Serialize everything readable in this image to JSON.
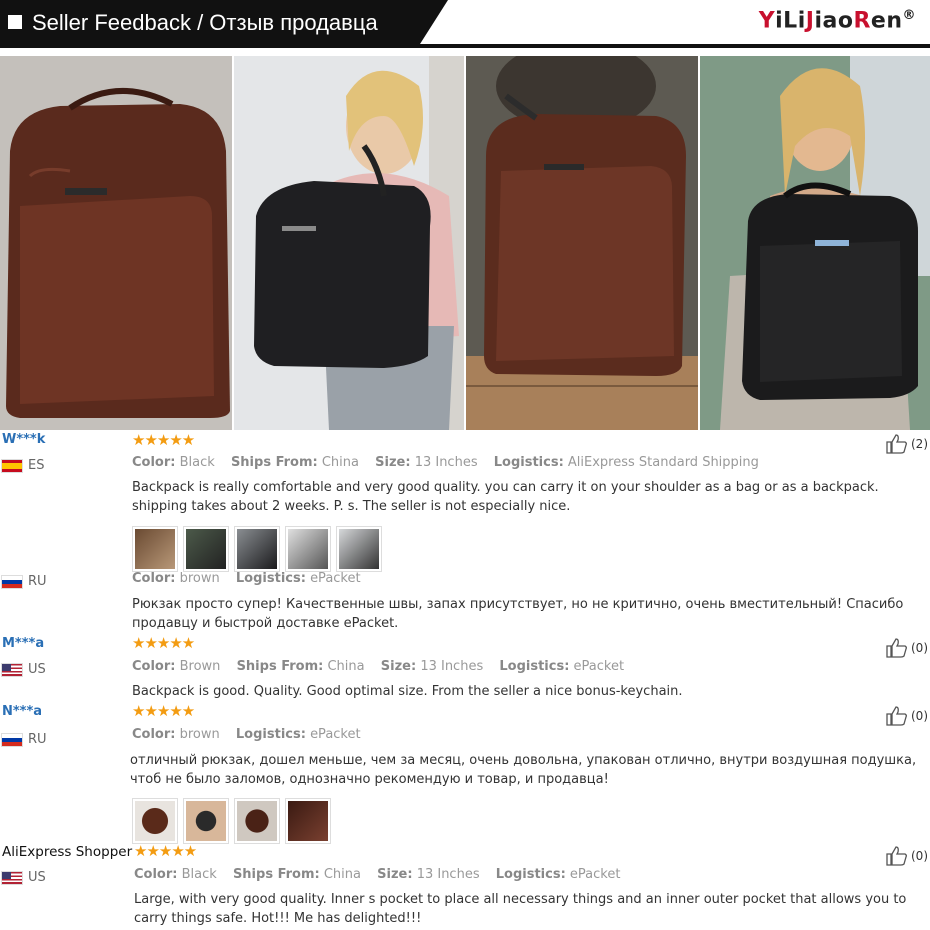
{
  "header": {
    "title": "Seller Feedback / Отзыв продавца",
    "brand": "YiLiJiaoRen",
    "brand_mark": "®"
  },
  "labels": {
    "color": "Color:",
    "ships_from": "Ships From:",
    "size": "Size:",
    "logistics": "Logistics:"
  },
  "stars": "★★★★★",
  "reviews": [
    {
      "user": "W***k",
      "country": "ES",
      "color": "Black",
      "ships_from": "China",
      "size": "13 Inches",
      "logistics": "AliExpress Standard Shipping",
      "text": "Backpack is really comfortable and very good quality. you can carry it on your shoulder as a bag or as a backpack. shipping takes about 2 weeks. P. s. The seller is not especially nice.",
      "likes": "(2)"
    },
    {
      "user": "",
      "country": "RU",
      "color": "brown",
      "logistics": "ePacket",
      "text": "Рюкзак просто супер! Качественные швы, запах присутствует, но не критично, очень вместительный! Спасибо продавцу и быстрой доставке ePacket."
    },
    {
      "user": "M***a",
      "country": "US",
      "color": "Brown",
      "ships_from": "China",
      "size": "13 Inches",
      "logistics": "ePacket",
      "text": "Backpack is good. Quality. Good optimal size. From the seller a nice bonus-keychain.",
      "likes": "(0)"
    },
    {
      "user": "N***a",
      "country": "RU",
      "color": "brown",
      "logistics": "ePacket",
      "text": "отличный рюкзак, дошел меньше, чем за месяц, очень довольна, упакован отлично, внутри воздушная подушка, чтоб не было заломов, однозначно рекомендую и товар, и продавца!",
      "likes": "(0)"
    },
    {
      "user": "AliExpress Shopper",
      "country": "US",
      "color": "Black",
      "ships_from": "China",
      "size": "13 Inches",
      "logistics": "ePacket",
      "text": "Large, with very good quality. Inner s pocket to place all necessary things and an inner outer pocket that allows you to carry things safe. Hot!!! Me has delighted!!!",
      "likes": "(0)"
    }
  ],
  "colors": {
    "username": "#2a6fb5",
    "stars": "#f39c12",
    "brand_red": "#c8102e",
    "header_bg": "#111111"
  }
}
